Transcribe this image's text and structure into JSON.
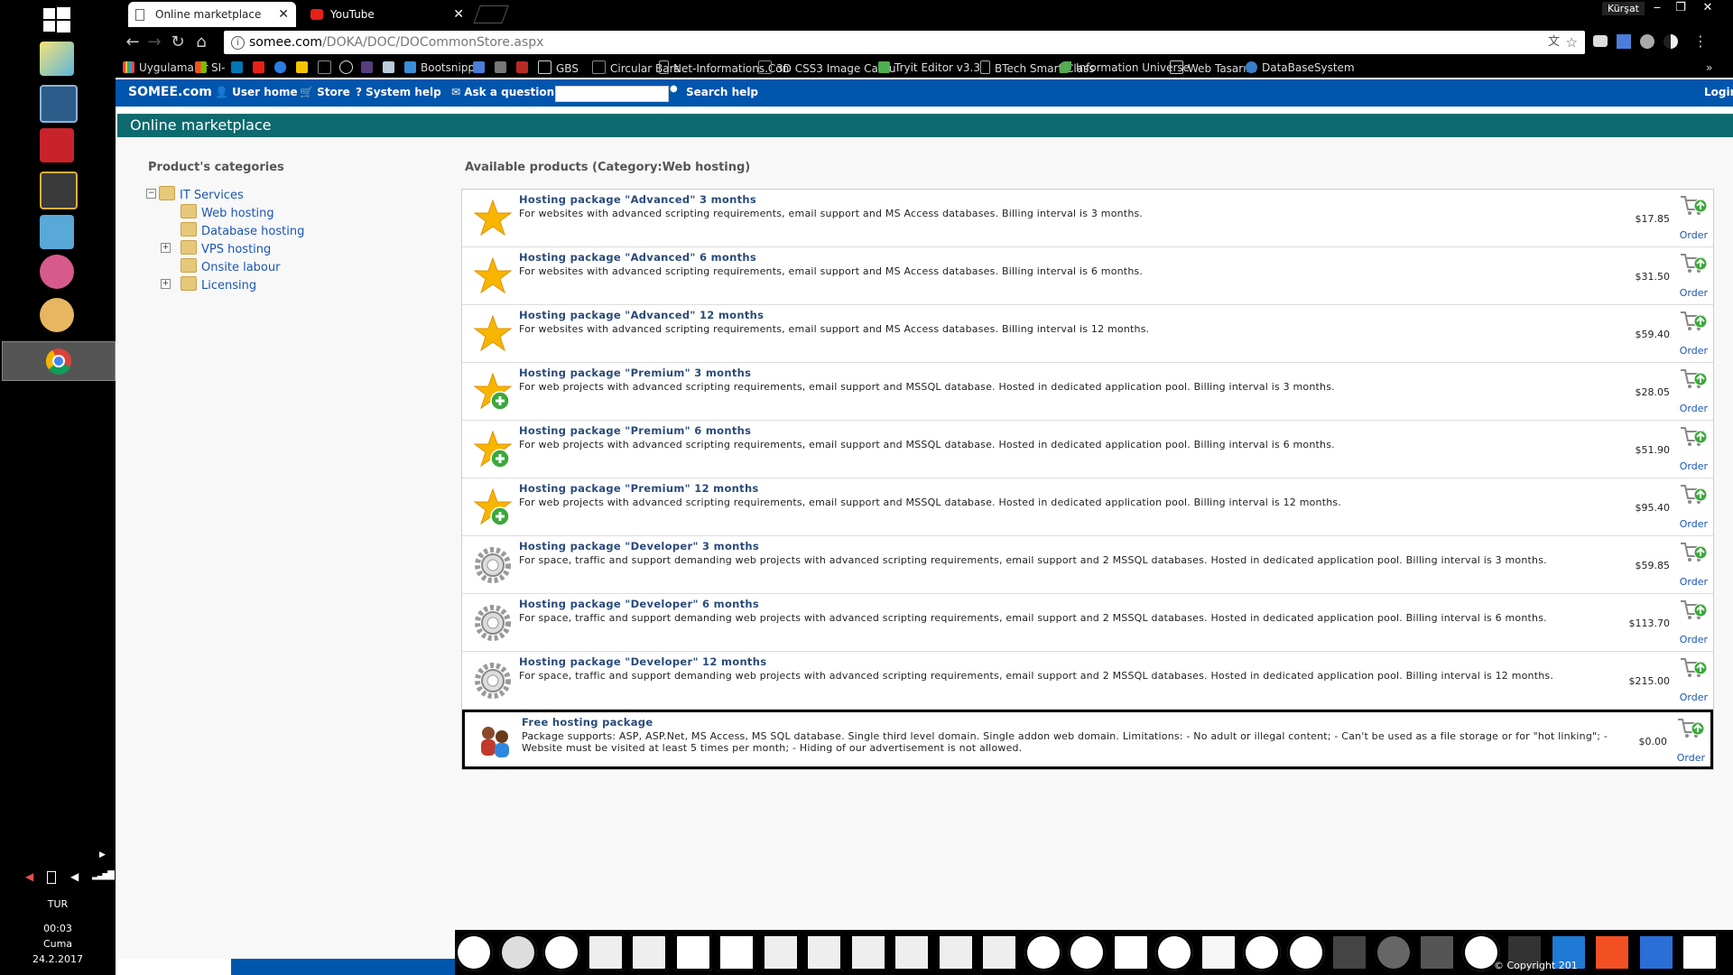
{
  "taskbar": {
    "language": "TUR",
    "time": "00:03",
    "day": "Cuma",
    "date": "24.2.2017"
  },
  "tabs": [
    {
      "label": "Online marketplace",
      "active": true
    },
    {
      "label": "YouTube",
      "active": false
    }
  ],
  "window": {
    "user": "Kürşat"
  },
  "address": {
    "host": "somee.com",
    "path": "/DOKA/DOC/DOCommonStore.aspx"
  },
  "bookmarks": [
    {
      "label": "Uygulamalar",
      "icon": "apps-grid-icon"
    },
    {
      "label": "SI-",
      "icon": "windows-icon"
    },
    {
      "label": "",
      "icon": "linkedin-icon"
    },
    {
      "label": "",
      "icon": "youtube-icon"
    },
    {
      "label": "",
      "icon": "onedrive-icon"
    },
    {
      "label": "",
      "icon": "link-icon"
    },
    {
      "label": "",
      "icon": "codepen-icon"
    },
    {
      "label": "",
      "icon": "react-icon"
    },
    {
      "label": "",
      "icon": "bootstrap-icon"
    },
    {
      "label": "",
      "icon": "chart-icon"
    },
    {
      "label": "Bootsnipp",
      "icon": "bootsnipp-icon"
    },
    {
      "label": "",
      "icon": "translate-icon"
    },
    {
      "label": "",
      "icon": "fit-icon"
    },
    {
      "label": "",
      "icon": "quora-icon"
    },
    {
      "label": "GBS",
      "icon": "gbs-icon"
    },
    {
      "label": "Circular Bars",
      "icon": "codepen-icon"
    },
    {
      "label": "Net-Informations.Con",
      "icon": "page-icon"
    },
    {
      "label": "3D CSS3 Image Carou",
      "icon": "codepen-icon"
    },
    {
      "label": "Tryit Editor v3.3",
      "icon": "w3-icon"
    },
    {
      "label": "BTech Smart Class",
      "icon": "page-icon"
    },
    {
      "label": "Information Universe",
      "icon": "leaf-icon"
    },
    {
      "label": "Web Tasarım",
      "icon": "web-icon"
    },
    {
      "label": "DataBaseSystem",
      "icon": "globe-icon"
    }
  ],
  "sitenav": {
    "brand": "SOMEE.com",
    "user_home": "User home",
    "store": "Store",
    "system_help": "System help",
    "ask": "Ask a question",
    "search_help": "Search help",
    "login": "Login"
  },
  "page": {
    "title": "Online marketplace",
    "categories_title": "Product's categories",
    "products_title": "Available products (Category:Web hosting)"
  },
  "categories": [
    {
      "label": "IT Services",
      "expander": "−"
    },
    {
      "label": "Web hosting",
      "expander": ""
    },
    {
      "label": "Database hosting",
      "expander": ""
    },
    {
      "label": "VPS hosting",
      "expander": "+"
    },
    {
      "label": "Onsite labour",
      "expander": ""
    },
    {
      "label": "Licensing",
      "expander": "+"
    }
  ],
  "products": [
    {
      "name": "Hosting package \"Advanced\" 3 months",
      "desc": "For websites with advanced scripting requirements, email support and MS Access databases. Billing interval is 3 months.",
      "price": "$17.85",
      "order": "Order",
      "icon": "star-icon"
    },
    {
      "name": "Hosting package \"Advanced\" 6 months",
      "desc": "For websites with advanced scripting requirements, email support and MS Access databases. Billing interval is 6 months.",
      "price": "$31.50",
      "order": "Order",
      "icon": "star-icon"
    },
    {
      "name": "Hosting package \"Advanced\" 12 months",
      "desc": "For websites with advanced scripting requirements, email support and MS Access databases. Billing interval is 12 months.",
      "price": "$59.40",
      "order": "Order",
      "icon": "star-icon"
    },
    {
      "name": "Hosting package \"Premium\" 3 months",
      "desc": "For web projects with advanced scripting requirements, email support and MSSQL database. Hosted in dedicated application pool. Billing interval is 3 months.",
      "price": "$28.05",
      "order": "Order",
      "icon": "star-plus-icon"
    },
    {
      "name": "Hosting package \"Premium\" 6 months",
      "desc": "For web projects with advanced scripting requirements, email support and MSSQL database. Hosted in dedicated application pool. Billing interval is 6 months.",
      "price": "$51.90",
      "order": "Order",
      "icon": "star-plus-icon"
    },
    {
      "name": "Hosting package \"Premium\" 12 months",
      "desc": "For web projects with advanced scripting requirements, email support and MSSQL database. Hosted in dedicated application pool. Billing interval is 12 months.",
      "price": "$95.40",
      "order": "Order",
      "icon": "star-plus-icon"
    },
    {
      "name": "Hosting package \"Developer\" 3 months",
      "desc": "For space, traffic and support demanding web projects with advanced scripting requirements, email support and 2 MSSQL databases. Hosted in dedicated application pool. Billing interval is 3 months.",
      "price": "$59.85",
      "order": "Order",
      "icon": "gear-icon"
    },
    {
      "name": "Hosting package \"Developer\" 6 months",
      "desc": "For space, traffic and support demanding web projects with advanced scripting requirements, email support and 2 MSSQL databases. Hosted in dedicated application pool. Billing interval is 6 months.",
      "price": "$113.70",
      "order": "Order",
      "icon": "gear-icon"
    },
    {
      "name": "Hosting package \"Developer\" 12 months",
      "desc": "For space, traffic and support demanding web projects with advanced scripting requirements, email support and 2 MSSQL databases. Hosted in dedicated application pool. Billing interval is 12 months.",
      "price": "$215.00",
      "order": "Order",
      "icon": "gear-icon"
    },
    {
      "name": "Free hosting package",
      "desc": "Package supports: ASP, ASP.Net, MS Access, MS SQL database. Single third level domain. Single addon web domain. Limitations: - No adult or illegal content; - Can't be used as a file storage or for \"hot linking\"; - Website must be visited at least 5 times per month; - Hiding of our advertisement is not allowed.",
      "price": "$0.00",
      "order": "Order",
      "icon": "people-icon"
    }
  ],
  "footer": {
    "copyright": "© Copyright 201"
  },
  "colors": {
    "site_bar": "#0055ad",
    "title_bar": "#0d6a6e",
    "link": "#1a55b5"
  }
}
